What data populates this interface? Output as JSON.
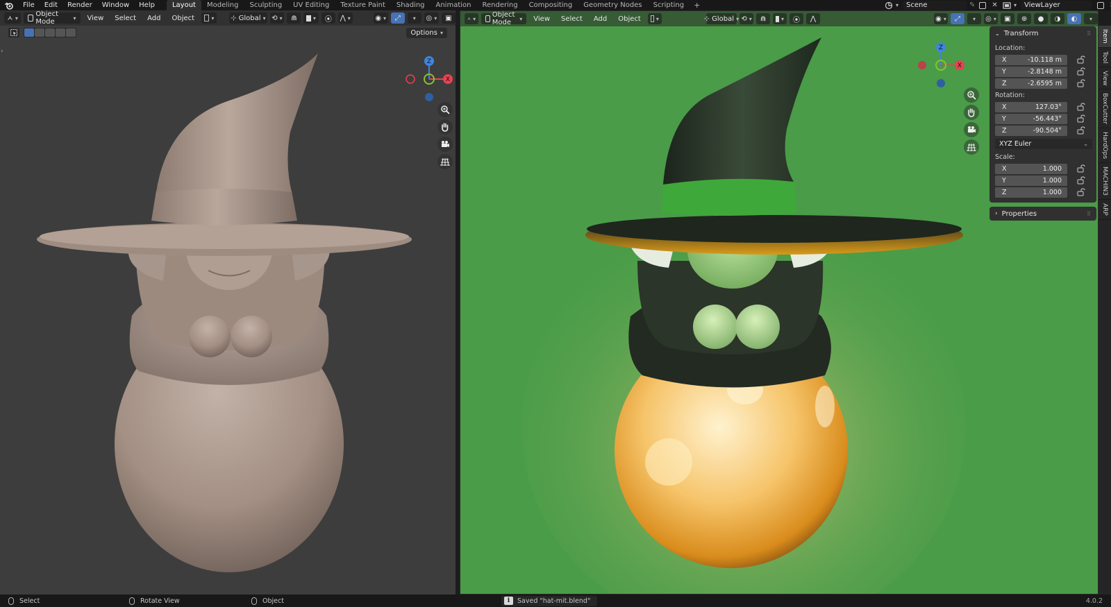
{
  "menubar": {
    "items": [
      "File",
      "Edit",
      "Render",
      "Window",
      "Help"
    ],
    "workspaces": [
      "Layout",
      "Modeling",
      "Sculpting",
      "UV Editing",
      "Texture Paint",
      "Shading",
      "Animation",
      "Rendering",
      "Compositing",
      "Geometry Nodes",
      "Scripting"
    ],
    "active_workspace": "Layout",
    "add_tab": "+",
    "scene_name": "Scene",
    "view_layer_name": "ViewLayer"
  },
  "viewport_left": {
    "mode": "Object Mode",
    "menus": [
      "View",
      "Select",
      "Add",
      "Object"
    ],
    "orientation": "Global",
    "options_label": "Options",
    "background": "#3d3d3d"
  },
  "viewport_right": {
    "mode": "Object Mode",
    "menus": [
      "View",
      "Select",
      "Add",
      "Object"
    ],
    "orientation": "Global",
    "background": "#4a9c48"
  },
  "gizmo_axes": {
    "z": "Z",
    "x": "X"
  },
  "npanel": {
    "transform_title": "Transform",
    "location_label": "Location:",
    "location": [
      {
        "axis": "X",
        "value": "-10.118 m"
      },
      {
        "axis": "Y",
        "value": "-2.8148 m"
      },
      {
        "axis": "Z",
        "value": "-2.6595 m"
      }
    ],
    "rotation_label": "Rotation:",
    "rotation": [
      {
        "axis": "X",
        "value": "127.03°"
      },
      {
        "axis": "Y",
        "value": "-56.443°"
      },
      {
        "axis": "Z",
        "value": "-90.504°"
      }
    ],
    "rotation_mode": "XYZ Euler",
    "scale_label": "Scale:",
    "scale": [
      {
        "axis": "X",
        "value": "1.000"
      },
      {
        "axis": "Y",
        "value": "1.000"
      },
      {
        "axis": "Z",
        "value": "1.000"
      }
    ],
    "properties_title": "Properties"
  },
  "side_tabs": [
    "Item",
    "Tool",
    "View",
    "BoxCutter",
    "HardOps",
    "MACHIN3",
    "ARP"
  ],
  "statusbar": {
    "select": "Select",
    "rotate_view": "Rotate View",
    "object": "Object",
    "report": "Saved \"hat-mit.blend\"",
    "version": "4.0.2"
  },
  "colors": {
    "accent": "#4772b3",
    "axis_x": "#e8434f",
    "axis_y": "#8bc32e",
    "axis_z": "#3e85e0"
  }
}
